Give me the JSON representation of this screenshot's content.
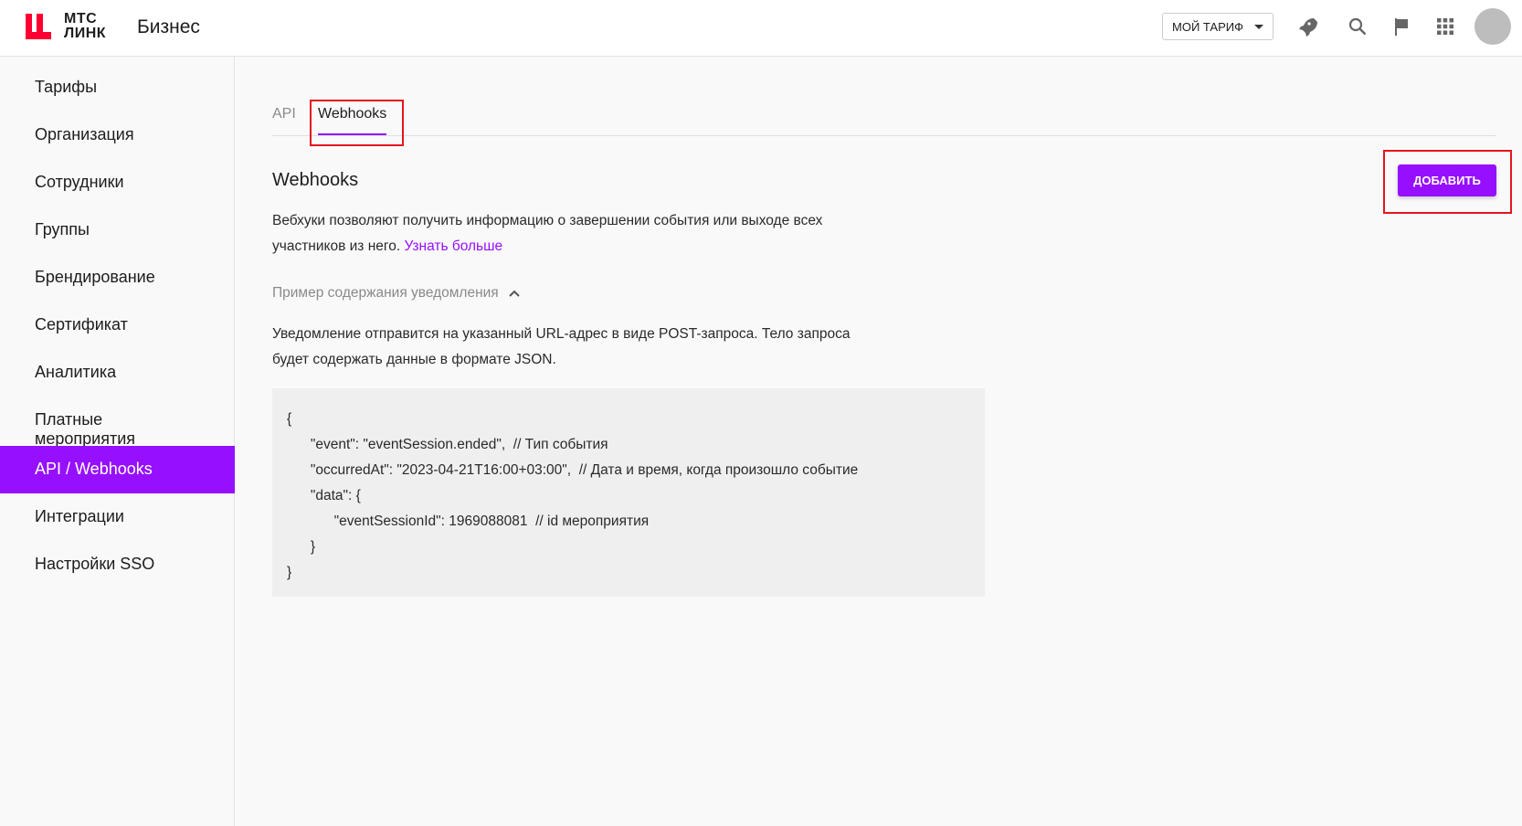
{
  "header": {
    "logo_line1": "МТС",
    "logo_line2": "ЛИНК",
    "brand": "Бизнес",
    "tariff_label": "МОЙ ТАРИФ",
    "brand_color": "#ff0032"
  },
  "sidebar": {
    "items": [
      {
        "label": "Тарифы"
      },
      {
        "label": "Организация"
      },
      {
        "label": "Сотрудники"
      },
      {
        "label": "Группы"
      },
      {
        "label": "Брендирование"
      },
      {
        "label": "Сертификат"
      },
      {
        "label": "Аналитика"
      },
      {
        "label": "Платные мероприятия"
      },
      {
        "label": "API / Webhooks",
        "active": true
      },
      {
        "label": "Интеграции"
      },
      {
        "label": "Настройки SSO"
      }
    ]
  },
  "tabs": [
    {
      "label": "API"
    },
    {
      "label": "Webhooks",
      "active": true
    }
  ],
  "main": {
    "title": "Webhooks",
    "add_button": "ДОБАВИТЬ",
    "description": "Вебхуки позволяют получить информацию о завершении события или выходе всех участников из него.",
    "learn_more": "Узнать больше",
    "example_toggle": "Пример содержания уведомления",
    "example_text": "Уведомление отправится на указанный URL-адрес в виде POST-запроса. Тело запроса будет содержать данные в формате JSON.",
    "code_lines": [
      "{",
      "      \"event\": \"eventSession.ended\",  // Тип события",
      "      \"occurredAt\": \"2023-04-21T16:00+03:00\",  // Дата и время, когда произошло событие",
      "      \"data\": {",
      "            \"eventSessionId\": 1969088081  // id мероприятия",
      "      }",
      "}"
    ]
  },
  "accent": "#9610ff"
}
